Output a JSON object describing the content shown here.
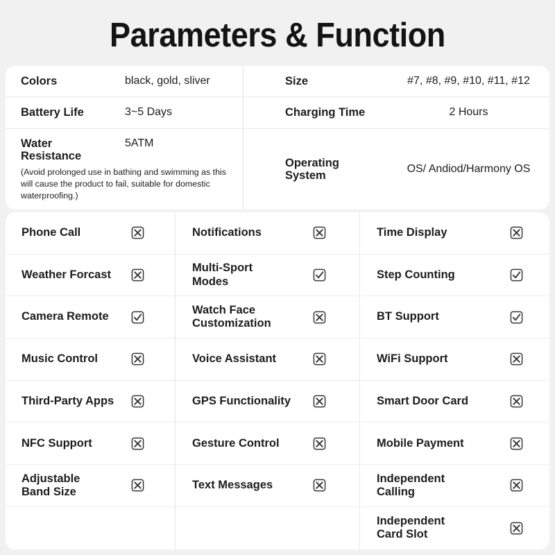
{
  "header": {
    "title": "Parameters & Function"
  },
  "colors": {
    "page_background": "#f1f1f1",
    "card_background": "#ffffff",
    "text": "#1c1c1c",
    "divider": "#e9e9e9",
    "icon": "#3a3a3a"
  },
  "spec_table": {
    "left": [
      {
        "label": "Colors",
        "value": "black, gold, sliver"
      },
      {
        "label": "Battery Life",
        "value": "3~5 Days"
      },
      {
        "label": "Water\nResistance",
        "label_line1": "Water",
        "label_line2": "Resistance",
        "value": "5ATM",
        "note": "(Avoid prolonged use in bathing and swimming as this will cause the product to fail, suitable for domestic waterproofing.)"
      }
    ],
    "right": [
      {
        "label": "Size",
        "value": "#7, #8, #9, #10, #11, #12"
      },
      {
        "label": "Charging Time",
        "value": "2 Hours"
      },
      {
        "label": "Operating System",
        "label_line1": "Operating",
        "label_line2": "System",
        "value": "OS/ Andiod/Harmony OS"
      }
    ]
  },
  "feature_grid": {
    "column_1": [
      {
        "label": "Phone Call",
        "state": "x"
      },
      {
        "label": "Weather Forcast",
        "state": "x"
      },
      {
        "label": "Camera Remote",
        "state": "check"
      },
      {
        "label": "Music Control",
        "state": "x"
      },
      {
        "label": "Third-Party Apps",
        "state": "x"
      },
      {
        "label": "NFC Support",
        "state": "x"
      },
      {
        "label": "Adjustable Band Size",
        "label_line1": "Adjustable",
        "label_line2": "Band Size",
        "state": "x"
      }
    ],
    "column_2": [
      {
        "label": "Notifications",
        "state": "x"
      },
      {
        "label": "Multi-Sport Modes",
        "label_line1": "Multi-Sport",
        "label_line2": "Modes",
        "state": "check"
      },
      {
        "label": "Watch Face Customization",
        "label_line1": "Watch Face",
        "label_line2": "Customization",
        "state": "x"
      },
      {
        "label": "Voice Assistant",
        "state": "x"
      },
      {
        "label": "GPS Functionality",
        "state": "x"
      },
      {
        "label": "Gesture Control",
        "state": "x"
      },
      {
        "label": "Text Messages",
        "state": "x"
      }
    ],
    "column_3": [
      {
        "label": "Time Display",
        "state": "x"
      },
      {
        "label": "Step Counting",
        "state": "check"
      },
      {
        "label": "BT Support",
        "state": "check"
      },
      {
        "label": "WiFi Support",
        "state": "x"
      },
      {
        "label": "Smart Door Card",
        "state": "x"
      },
      {
        "label": "Mobile Payment",
        "state": "x"
      },
      {
        "label": "Independent Calling",
        "label_line1": "Independent",
        "label_line2": "Calling",
        "state": "x"
      },
      {
        "label": "Independent Card Slot",
        "label_line1": "Independent",
        "label_line2": "Card Slot",
        "state": "x"
      }
    ]
  },
  "icons": {
    "x_box": "x-box-icon",
    "check_box": "check-box-icon"
  }
}
